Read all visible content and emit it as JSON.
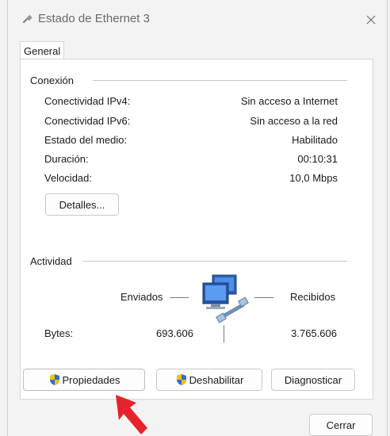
{
  "window": {
    "title": "Estado de Ethernet 3"
  },
  "tabs": [
    {
      "label": "General"
    }
  ],
  "connection": {
    "group_label": "Conexión",
    "rows": [
      {
        "label": "Conectividad IPv4:",
        "value": "Sin acceso a Internet"
      },
      {
        "label": "Conectividad IPv6:",
        "value": "Sin acceso a la red"
      },
      {
        "label": "Estado del medio:",
        "value": "Habilitado"
      },
      {
        "label": "Duración:",
        "value": "00:10:31"
      },
      {
        "label": "Velocidad:",
        "value": "10,0 Mbps"
      }
    ],
    "details_button": "Detalles..."
  },
  "activity": {
    "group_label": "Actividad",
    "sent_label": "Enviados",
    "received_label": "Recibidos",
    "bytes_label": "Bytes:",
    "bytes_sent": "693.606",
    "bytes_received": "3.765.606"
  },
  "actions": {
    "properties": "Propiedades",
    "disable": "Deshabilitar",
    "diagnose": "Diagnosticar"
  },
  "footer": {
    "close": "Cerrar"
  },
  "colors": {
    "window_bg": "#f3f3f3",
    "panel_bg": "#ffffff",
    "annotation_arrow": "#e8212b",
    "shield_blue": "#2f6fd6",
    "shield_yellow": "#f2c200"
  },
  "icons": {
    "title": "ethernet-cable-icon",
    "close": "close-icon",
    "network": "network-computers-icon",
    "shield": "uac-shield-icon",
    "annotation": "red-arrow-annotation"
  }
}
